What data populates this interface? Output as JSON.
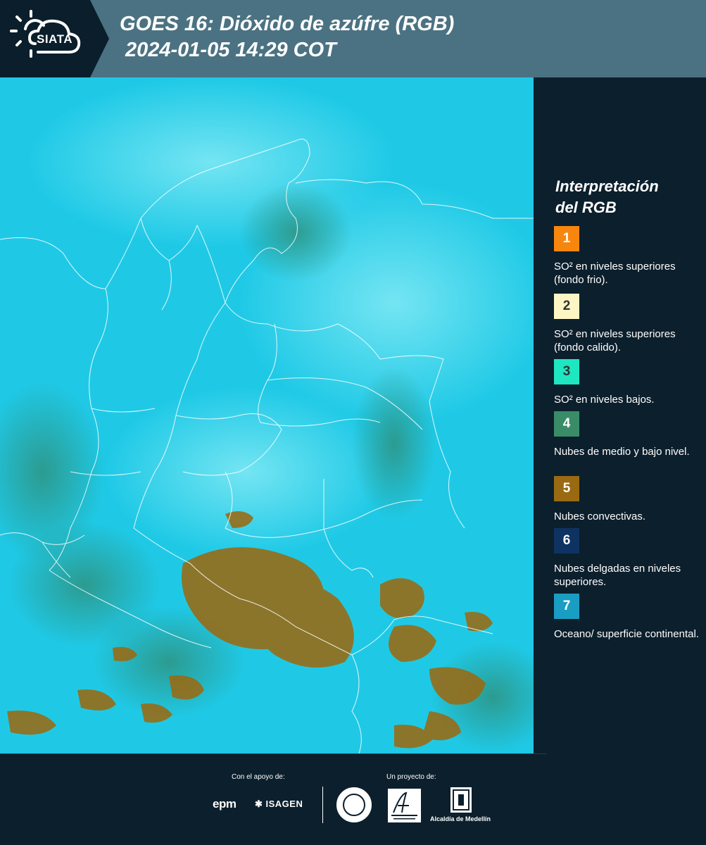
{
  "header": {
    "logo_text": "SIATA",
    "title_line1": "GOES 16: Dióxido de azúfre (RGB)",
    "title_line2": "2024-01-05 14:29 COT"
  },
  "legend": {
    "title_line1": "Interpretación",
    "title_line2": "del RGB",
    "items": [
      {
        "number": "1",
        "label": "SO² en niveles superiores (fondo frio).",
        "color": "#f7860f"
      },
      {
        "number": "2",
        "label": "SO² en niveles superiores (fondo calido).",
        "color": "#fdf6c4"
      },
      {
        "number": "3",
        "label": "SO² en niveles bajos.",
        "color": "#1ee6c1"
      },
      {
        "number": "4",
        "label": "Nubes de medio y bajo nivel.",
        "color": "#3a8c68"
      },
      {
        "number": "5",
        "label": "Nubes convectivas.",
        "color": "#9a6a12"
      },
      {
        "number": "6",
        "label": "Nubes delgadas en niveles superiores.",
        "color": "#0e3262"
      },
      {
        "number": "7",
        "label": "Oceano/ superficie continental.",
        "color": "#1a9dc2"
      }
    ]
  },
  "footer": {
    "support_label": "Con el apoyo de:",
    "project_label": "Un proyecto de:",
    "epm": "epm",
    "isagen": "ISAGEN",
    "alcaldia": "Alcaldía de Medellín"
  },
  "colors": {
    "header_bg": "#4b7282",
    "panel_bg": "#0c1f2c",
    "map_base": "#1fc9e6",
    "convective": "#9a6a12",
    "mid_low_clouds": "#3a8c68"
  }
}
